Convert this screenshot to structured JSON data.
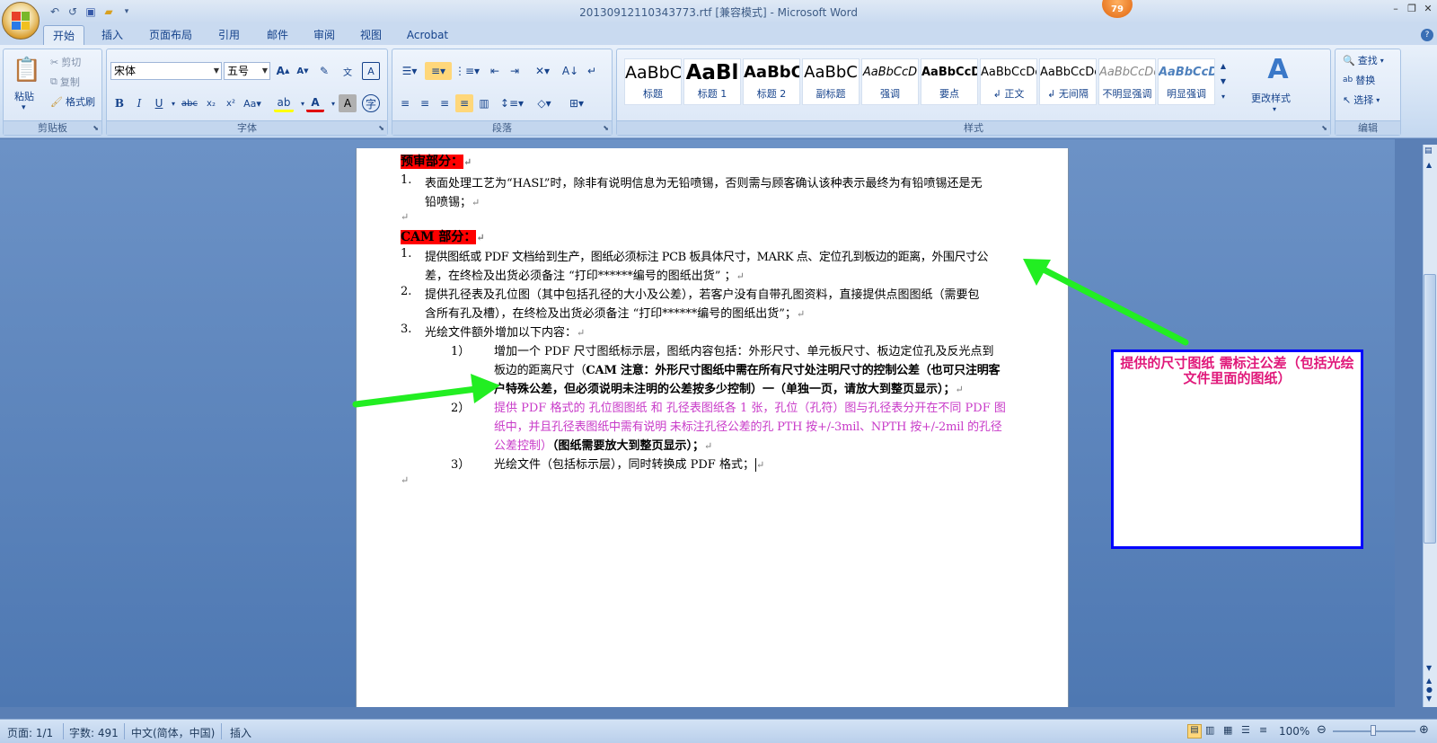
{
  "window": {
    "title": "20130912110343773.rtf [兼容模式] - Microsoft Word",
    "badge": "79",
    "controls": [
      "–",
      "❐",
      "✕"
    ]
  },
  "qat": {
    "icons": [
      "undo-icon",
      "redo-icon",
      "save-icon",
      "open-icon"
    ],
    "glyphs": [
      "↶",
      "↺",
      "💾",
      "📂",
      "▾"
    ]
  },
  "tabs": [
    "开始",
    "插入",
    "页面布局",
    "引用",
    "邮件",
    "审阅",
    "视图",
    "Acrobat"
  ],
  "ribbon": {
    "clipboard": {
      "label": "剪贴板",
      "paste": "粘贴",
      "cut": "剪切",
      "copy": "复制",
      "format_painter": "格式刷"
    },
    "font": {
      "label": "字体",
      "font_name": "宋体",
      "font_size": "五号"
    },
    "paragraph": {
      "label": "段落"
    },
    "styles": {
      "label": "样式",
      "items": [
        {
          "sample": "AaBbC",
          "name": "标题"
        },
        {
          "sample": "AaBl",
          "name": "标题 1"
        },
        {
          "sample": "AaBbC",
          "name": "标题 2"
        },
        {
          "sample": "AaBbC",
          "name": "副标题"
        },
        {
          "sample": "AaBbCcD",
          "name": "强调"
        },
        {
          "sample": "AaBbCcD",
          "name": "要点"
        },
        {
          "sample": "AaBbCcDc",
          "name": "↲ 正文"
        },
        {
          "sample": "AaBbCcDc",
          "name": "↲ 无间隔"
        },
        {
          "sample": "AaBbCcDc",
          "name": "不明显强调"
        },
        {
          "sample": "AaBbCcDc",
          "name": "明显强调"
        }
      ],
      "change_styles": "更改样式"
    },
    "editing": {
      "label": "编辑",
      "find": "查找",
      "replace": "替换",
      "select": "选择"
    }
  },
  "document": {
    "heading1": "预审部分：",
    "p1_num": "1.",
    "p1_line1": "表面处理工艺为“HASL”时，除非有说明信息为无铅喷锡，否则需与顾客确认该种表示最终为有铅喷锡还是无",
    "p1_line2": "铅喷锡；",
    "heading2": "CAM 部分：",
    "c1_num": "1.",
    "c1_line1": "提供图纸或 PDF 文档给到生产，图纸必须标注 PCB 板具体尺寸，MARK 点、定位孔到板边的距离，外围尺寸公",
    "c1_line2": "差，在终检及出货必须备注 “打印******编号的图纸出货” ；",
    "c2_num": "2.",
    "c2_line1": "提供孔径表及孔位图（其中包括孔径的大小及公差），若客户没有自带孔图资料，直接提供点图图纸（需要包",
    "c2_line2": "含所有孔及槽），在终检及出货必须备注 “打印******编号的图纸出货”；",
    "c3_num": "3.",
    "c3_line1": "光绘文件额外增加以下内容：",
    "s1_num": "1）",
    "s1_line1": "增加一个 PDF 尺寸图纸标示层，图纸内容包括：外形尺寸、单元板尺寸、板边定位孔及反光点到",
    "s1_line2_plain": "板边的距离尺寸（",
    "s1_line2_bold": "CAM 注意：外形尺寸图纸中需在所有尺寸处注明尺寸的控制公差（也可只注明客",
    "s1_line3": "户特殊公差，但必须说明未注明的公差按多少控制）一（单独一页，请放大到整页显示）；",
    "s2_num": "2）",
    "s2_line1": "提供 PDF 格式的 孔位图图纸 和 孔径表图纸各 1 张，孔位（孔符）图与孔径表分开在不同 PDF 图",
    "s2_line2": "纸中，并且孔径表图纸中需有说明 未标注孔径公差的孔 PTH 按+/-3mil、NPTH 按+/-2mil 的孔径",
    "s2_line3_magenta": "公差控制）",
    "s2_line3_bold": "（图纸需要放大到整页显示）；",
    "s3_num": "3）",
    "s3_line1": "光绘文件（包括标示层），同时转换成 PDF 格式；",
    "return_mark": "↵"
  },
  "annotation": {
    "text": "提供的尺寸图纸 需标注公差（包括光绘文件里面的图纸）",
    "arrow_color": "#22ee22",
    "border_color": "#0000ff",
    "text_color": "#e0187a"
  },
  "statusbar": {
    "page": "页面: 1/1",
    "words": "字数: 491",
    "language": "中文(简体，中国)",
    "mode": "插入",
    "zoom": "100%"
  }
}
